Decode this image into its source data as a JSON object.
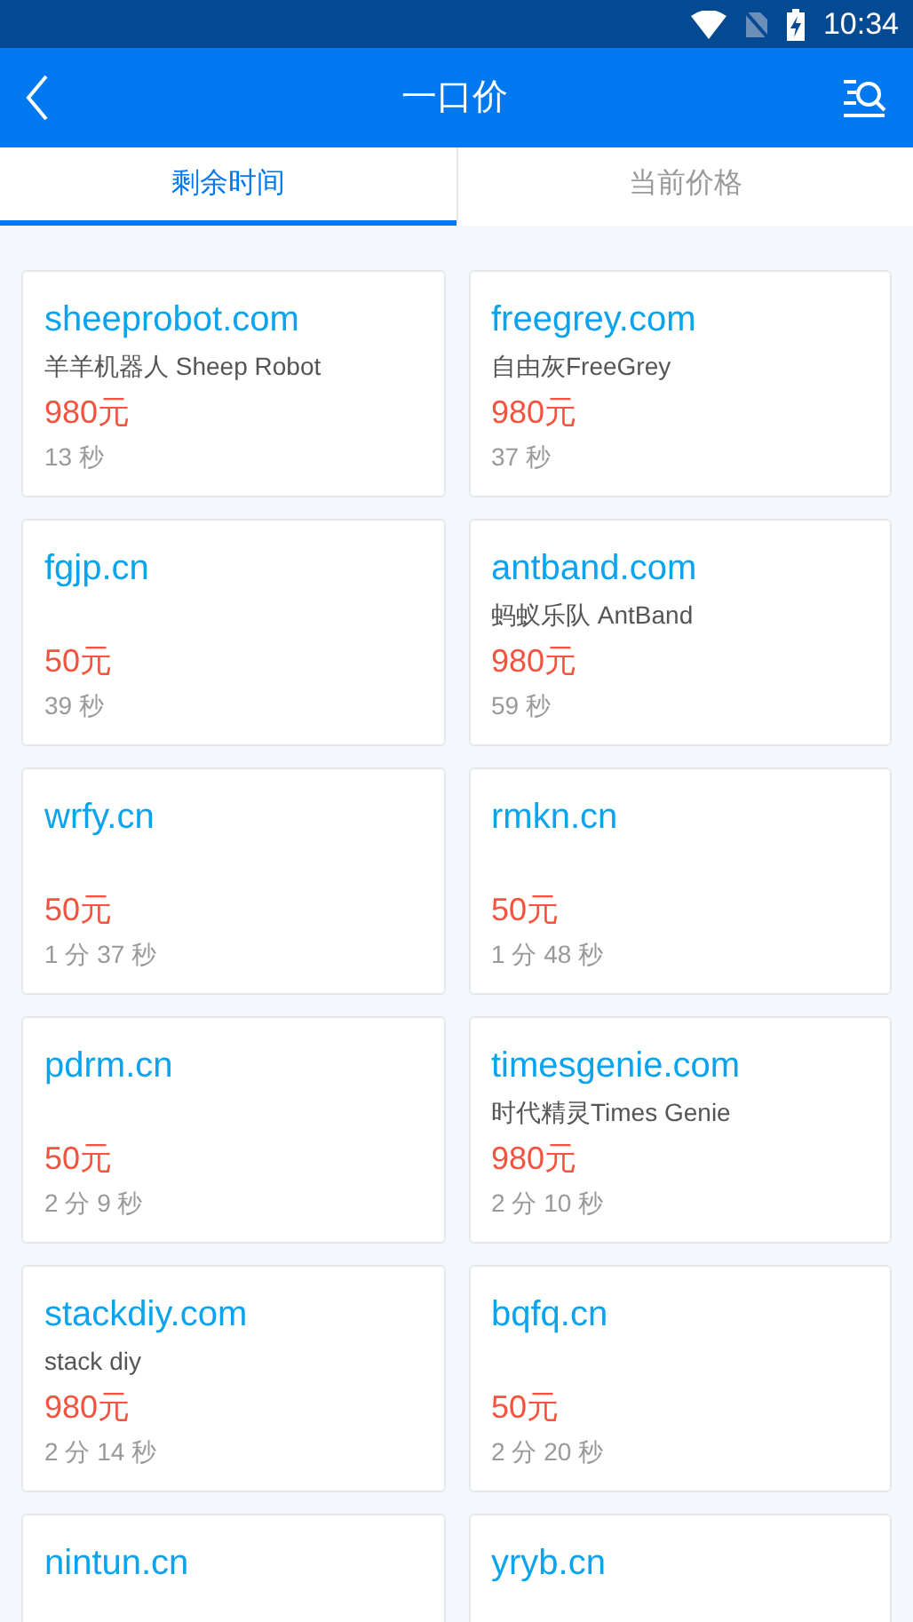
{
  "status_bar": {
    "time": "10:34"
  },
  "header": {
    "title": "一口价"
  },
  "tabs": [
    {
      "label": "剩余时间",
      "selected": true
    },
    {
      "label": "当前价格",
      "selected": false
    }
  ],
  "listings": [
    {
      "domain": "sheeprobot.com",
      "subtitle": "羊羊机器人 Sheep Robot",
      "price": "980元",
      "time_left": "13 秒"
    },
    {
      "domain": "freegrey.com",
      "subtitle": "自由灰FreeGrey",
      "price": "980元",
      "time_left": "37 秒"
    },
    {
      "domain": "fgjp.cn",
      "price": "50元",
      "time_left": "39 秒"
    },
    {
      "domain": "antband.com",
      "subtitle": "蚂蚁乐队 AntBand",
      "price": "980元",
      "time_left": "59 秒"
    },
    {
      "domain": "wrfy.cn",
      "price": "50元",
      "time_left": "1 分 37 秒"
    },
    {
      "domain": "rmkn.cn",
      "price": "50元",
      "time_left": "1 分 48 秒"
    },
    {
      "domain": "pdrm.cn",
      "price": "50元",
      "time_left": "2 分 9 秒"
    },
    {
      "domain": "timesgenie.com",
      "subtitle": "时代精灵Times Genie",
      "price": "980元",
      "time_left": "2 分 10 秒"
    },
    {
      "domain": "stackdiy.com",
      "subtitle": "stack diy",
      "price": "980元",
      "time_left": "2 分 14 秒"
    },
    {
      "domain": "bqfq.cn",
      "price": "50元",
      "time_left": "2 分 20 秒"
    },
    {
      "domain": "nintun.cn"
    },
    {
      "domain": "yryb.cn"
    }
  ]
}
